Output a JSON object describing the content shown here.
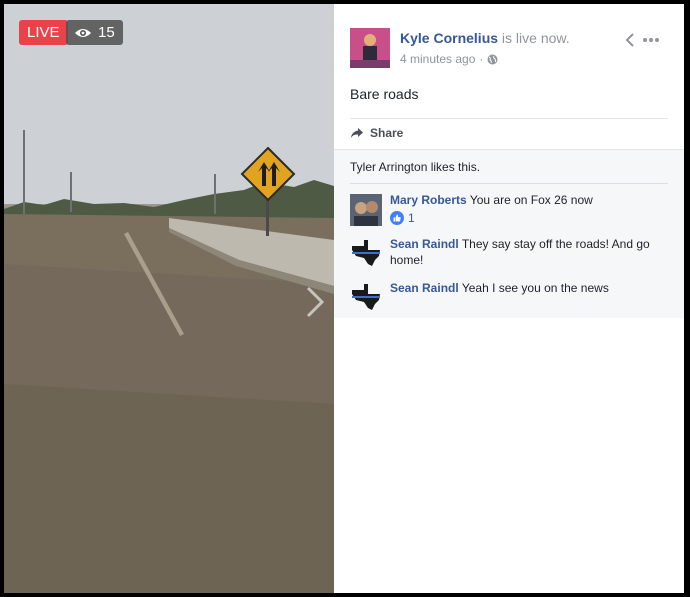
{
  "video": {
    "live_label": "LIVE",
    "viewer_count": "15",
    "icons": {
      "viewers": "eye-icon",
      "next": "chevron-right-icon"
    }
  },
  "post": {
    "author": "Kyle Cornelius",
    "status_suffix": "is live now.",
    "time": "4 minutes ago",
    "separator": "·",
    "text": "Bare roads",
    "share_label": "Share",
    "icons": {
      "privacy": "globe-icon",
      "back": "chevron-left-icon",
      "more": "more-dots-icon",
      "share": "share-arrow-icon"
    }
  },
  "likes_text": "Tyler Arrington likes this.",
  "comments": [
    {
      "author": "Mary Roberts",
      "text": "You are on Fox 26 now",
      "like_count": "1"
    },
    {
      "author": "Sean Raindl",
      "text": "They say stay off the roads! And go home!"
    },
    {
      "author": "Sean Raindl",
      "text": "Yeah I see you on the news"
    }
  ],
  "colors": {
    "live": "#e9424a",
    "link": "#365899",
    "meta": "#90949c",
    "like": "#4080ff"
  }
}
